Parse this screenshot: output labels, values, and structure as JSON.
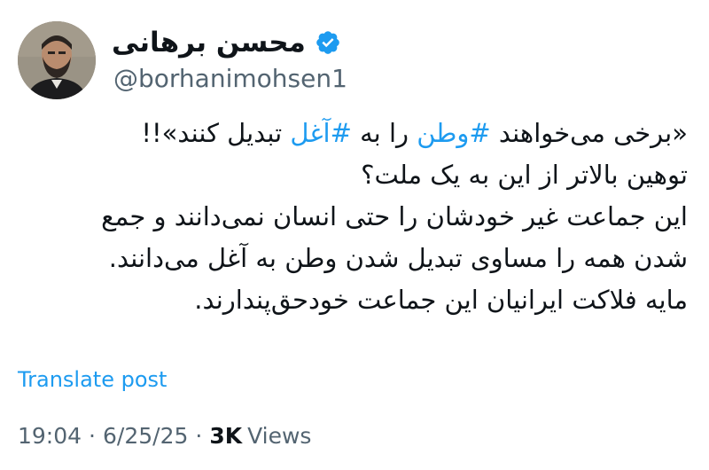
{
  "author": {
    "display_name": "محسن برهانی",
    "handle": "@borhanimohsen1",
    "verified": true
  },
  "tweet": {
    "line1": {
      "part1": "«برخی می‌خواهند ",
      "hashtag1": "#وطن",
      "part2": " را به ",
      "hashtag2": "#آغل",
      "part3": " تبدیل کنند»!!"
    },
    "line2": "توهین بالاتر از این به یک ملت؟",
    "line3": "این جماعت غیر خودشان را حتی انسان نمی‌دانند و جمع",
    "line4": "شدن همه را مساوی تبدیل شدن وطن به آغل می‌دانند.",
    "line5": "مایه فلاکت ایرانیان این جماعت خودحق‌پندارند."
  },
  "translate_label": "Translate post",
  "meta": {
    "time": "19:04",
    "date": "6/25/25",
    "separator": "·",
    "views_count": "3K",
    "views_label": "Views"
  },
  "colors": {
    "accent": "#1d9bf0",
    "text": "#0f1419",
    "secondary": "#536471"
  },
  "icons": {
    "verified": "verified-badge-icon",
    "avatar": "profile-photo"
  }
}
